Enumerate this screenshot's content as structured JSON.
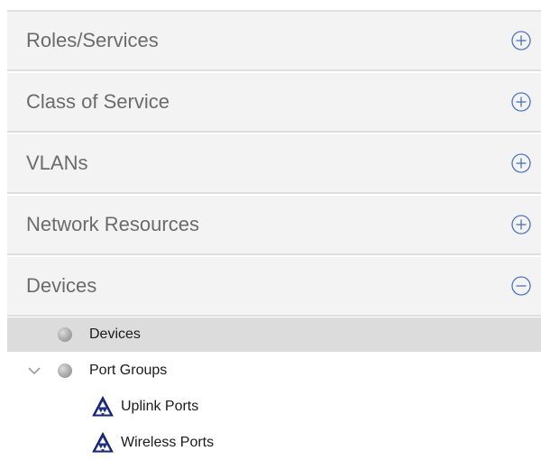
{
  "accordion": {
    "sections": [
      {
        "label": "Roles/Services",
        "state": "collapsed"
      },
      {
        "label": "Class of Service",
        "state": "collapsed"
      },
      {
        "label": "VLANs",
        "state": "collapsed"
      },
      {
        "label": "Network Resources",
        "state": "collapsed"
      },
      {
        "label": "Devices",
        "state": "expanded"
      }
    ]
  },
  "tree": {
    "items": [
      {
        "label": "Devices",
        "icon": "gray-sphere-icon",
        "selected": true
      },
      {
        "label": "Port Groups",
        "icon": "gray-sphere-icon",
        "expanded": true
      },
      {
        "label": "Uplink Ports",
        "icon": "port-group-triangle-icon"
      },
      {
        "label": "Wireless Ports",
        "icon": "port-group-triangle-icon"
      }
    ]
  },
  "colors": {
    "header_bg": "#f3f3f3",
    "header_text": "#6b6b6b",
    "toggle_icon": "#4a74b8",
    "selected_row": "#dcdcdc"
  }
}
